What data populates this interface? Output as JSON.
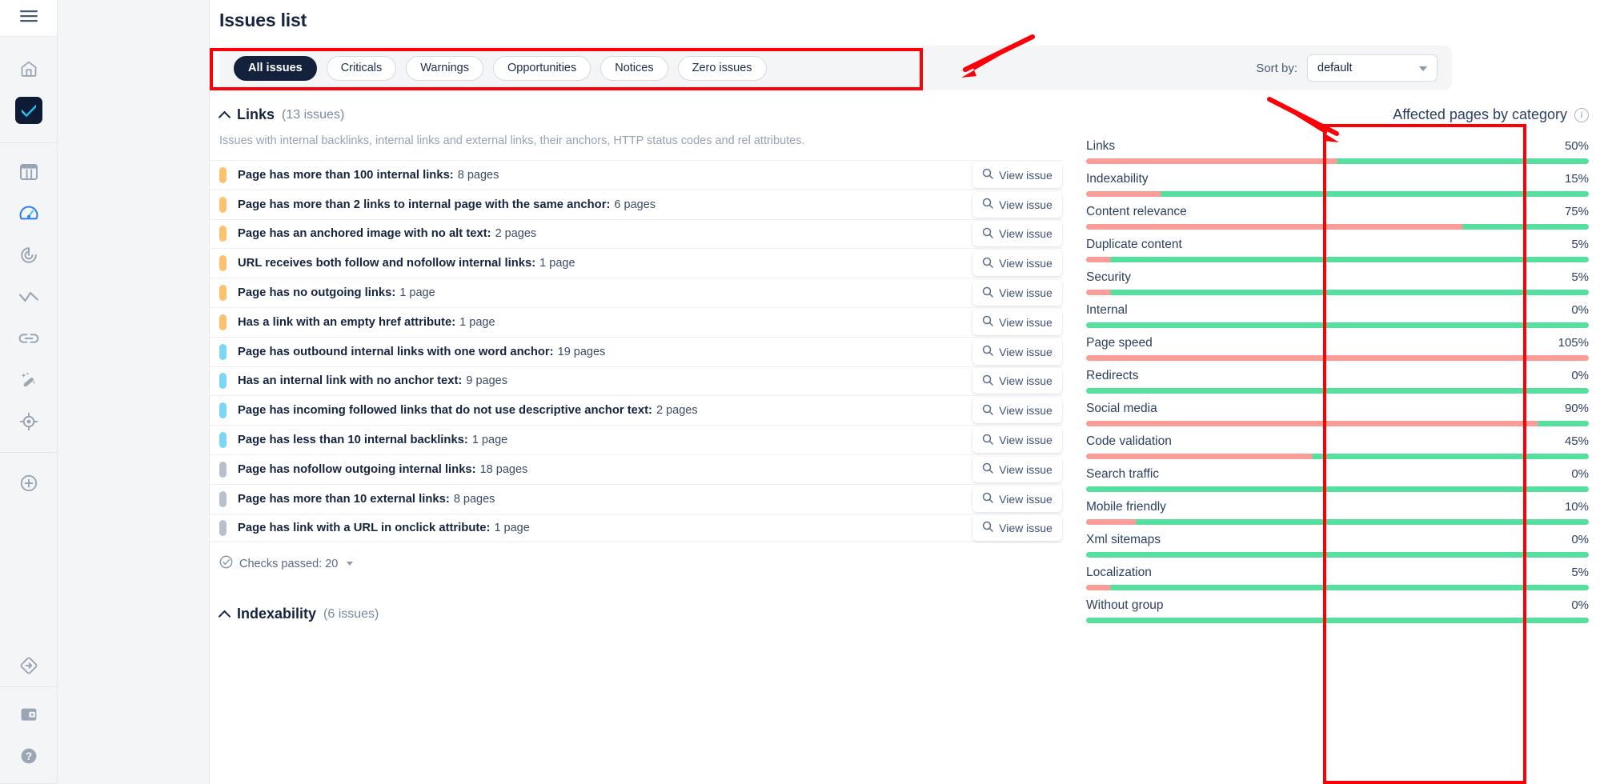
{
  "sidebar": {
    "menu_icon": "hamburger-menu-icon",
    "items": [
      {
        "name": "home-icon",
        "label": "Home"
      },
      {
        "name": "site-audit-brand-icon",
        "label": "Site Audit"
      },
      {
        "name": "table-columns-icon",
        "label": "Projects"
      },
      {
        "name": "dashboard-gauge-icon",
        "label": "Dashboard"
      },
      {
        "name": "target-rank-icon",
        "label": "Rank Tracker"
      },
      {
        "name": "analytics-line-icon",
        "label": "Analytics"
      },
      {
        "name": "link-chain-icon",
        "label": "Backlinks"
      },
      {
        "name": "magic-wand-icon",
        "label": "Tools"
      },
      {
        "name": "crosshair-target-icon",
        "label": "Competitors"
      },
      {
        "name": "plus-circle-icon",
        "label": "Add project"
      },
      {
        "name": "diamond-arrow-icon",
        "label": "Shortcuts"
      },
      {
        "name": "billing-card-icon",
        "label": "Billing"
      },
      {
        "name": "help-question-icon",
        "label": "Help"
      }
    ]
  },
  "header": {
    "title": "Issues list"
  },
  "filters": {
    "pills": [
      {
        "label": "All issues",
        "active": true
      },
      {
        "label": "Criticals",
        "active": false
      },
      {
        "label": "Warnings",
        "active": false
      },
      {
        "label": "Opportunities",
        "active": false
      },
      {
        "label": "Notices",
        "active": false
      },
      {
        "label": "Zero issues",
        "active": false
      }
    ],
    "sort_label": "Sort by:",
    "sort_value": "default"
  },
  "group": {
    "title": "Links",
    "count_text": "(13 issues)",
    "description": "Issues with internal backlinks, internal links and external links, their anchors, HTTP status codes and rel attributes.",
    "view_issue_label": "View issue",
    "checks_passed": "Checks passed: 20"
  },
  "issues": [
    {
      "title": "Page has more than 100 internal links:",
      "count": "8 pages",
      "severity": "warning"
    },
    {
      "title": "Page has more than 2 links to internal page with the same anchor:",
      "count": "6 pages",
      "severity": "warning"
    },
    {
      "title": "Page has an anchored image with no alt text:",
      "count": "2 pages",
      "severity": "warning"
    },
    {
      "title": "URL receives both follow and nofollow internal links:",
      "count": "1 page",
      "severity": "warning"
    },
    {
      "title": "Page has no outgoing links:",
      "count": "1 page",
      "severity": "warning"
    },
    {
      "title": "Has a link with an empty href attribute:",
      "count": "1 page",
      "severity": "warning"
    },
    {
      "title": "Page has outbound internal links with one word anchor:",
      "count": "19 pages",
      "severity": "notice"
    },
    {
      "title": "Has an internal link with no anchor text:",
      "count": "9 pages",
      "severity": "notice"
    },
    {
      "title": "Page has incoming followed links that do not use descriptive anchor text:",
      "count": "2 pages",
      "severity": "notice"
    },
    {
      "title": "Page has less than 10 internal backlinks:",
      "count": "1 page",
      "severity": "notice"
    },
    {
      "title": "Page has nofollow outgoing internal links:",
      "count": "18 pages",
      "severity": "neutral"
    },
    {
      "title": "Page has more than 10 external links:",
      "count": "8 pages",
      "severity": "neutral"
    },
    {
      "title": "Page has link with a URL in onclick attribute:",
      "count": "1 page",
      "severity": "neutral"
    }
  ],
  "next_group": {
    "title": "Indexability",
    "count_text": "(6 issues)"
  },
  "affected": {
    "title": "Affected pages by category",
    "info_icon": "info-circle-icon"
  },
  "severity_colors": {
    "warning": "#fcc26d",
    "notice": "#7bd7f5",
    "neutral": "#b9c0cd"
  },
  "chart_data": {
    "type": "bar",
    "title": "Affected pages by category",
    "xlabel": "",
    "ylabel": "",
    "ylim": [
      0,
      100
    ],
    "orientation": "horizontal",
    "note": "Each row is a progress track: red fill = affected share, green remainder = unaffected.",
    "colors": {
      "affected": "#fb9d96",
      "remaining": "#56e0a0"
    },
    "categories": [
      "Links",
      "Indexability",
      "Content relevance",
      "Duplicate content",
      "Security",
      "Internal",
      "Page speed",
      "Redirects",
      "Social media",
      "Code validation",
      "Search traffic",
      "Mobile friendly",
      "Xml sitemaps",
      "Localization",
      "Without group"
    ],
    "values": [
      50,
      15,
      75,
      5,
      5,
      0,
      105,
      0,
      90,
      45,
      0,
      10,
      0,
      5,
      0
    ],
    "labels": [
      "50%",
      "15%",
      "75%",
      "5%",
      "5%",
      "0%",
      "105%",
      "0%",
      "90%",
      "45%",
      "0%",
      "10%",
      "0%",
      "5%",
      "0%"
    ]
  },
  "annotations": {
    "boxes": [
      {
        "name": "filter-pills-highlight"
      },
      {
        "name": "affected-categories-highlight"
      }
    ],
    "arrows": [
      {
        "name": "arrow-to-filters"
      },
      {
        "name": "arrow-to-affected-categories"
      }
    ],
    "color": "#fb0007"
  }
}
